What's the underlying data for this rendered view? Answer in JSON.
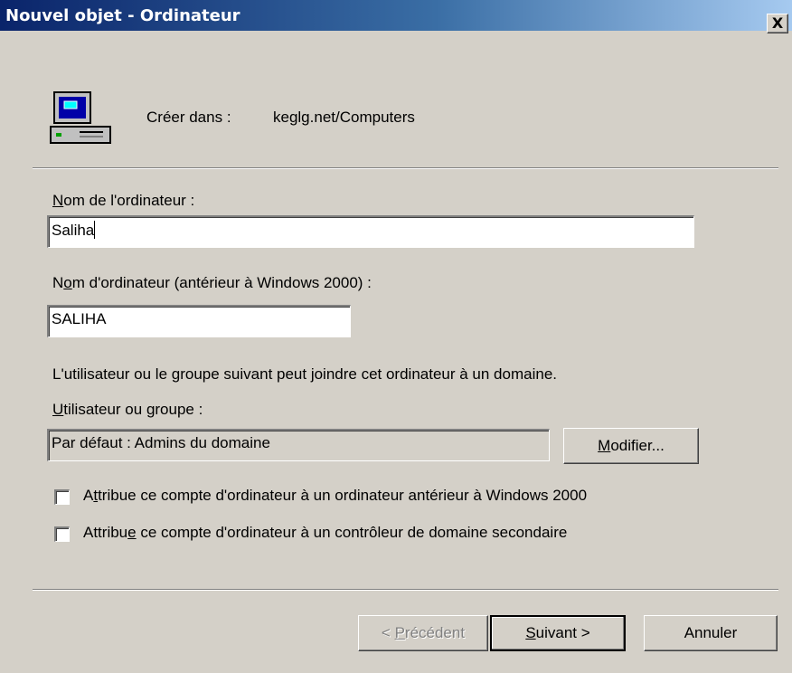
{
  "window": {
    "title": "Nouvel objet - Ordinateur",
    "close_glyph": "X"
  },
  "header": {
    "icon": "computer-icon",
    "create_in_label": "Créer dans :",
    "create_in_value": "keglg.net/Computers"
  },
  "computer_name": {
    "label_accel": "N",
    "label_rest": "om de l'ordinateur :",
    "value": "Saliha"
  },
  "pre2000_name": {
    "label_pre": "N",
    "label_accel": "o",
    "label_rest": "m d'ordinateur (antérieur à Windows 2000) :",
    "value": "SALIHA"
  },
  "join_domain": {
    "info_text": "L'utilisateur ou le groupe suivant peut joindre cet ordinateur à un domaine.",
    "label_accel": "U",
    "label_rest": "tilisateur ou groupe :",
    "value": "Par défaut : Admins du domaine",
    "modify_accel": "M",
    "modify_rest": "odifier..."
  },
  "options": [
    {
      "pre": "A",
      "accel": "t",
      "rest": "tribue ce compte d'ordinateur à un ordinateur antérieur à Windows 2000",
      "checked": false
    },
    {
      "pre": "Attribu",
      "accel": "e",
      "rest": " ce compte d'ordinateur à un contrôleur de domaine secondaire",
      "checked": false
    }
  ],
  "buttons": {
    "back_pre": "< ",
    "back_accel": "P",
    "back_rest": "récédent",
    "next_accel": "S",
    "next_rest": "uivant >",
    "cancel": "Annuler"
  }
}
